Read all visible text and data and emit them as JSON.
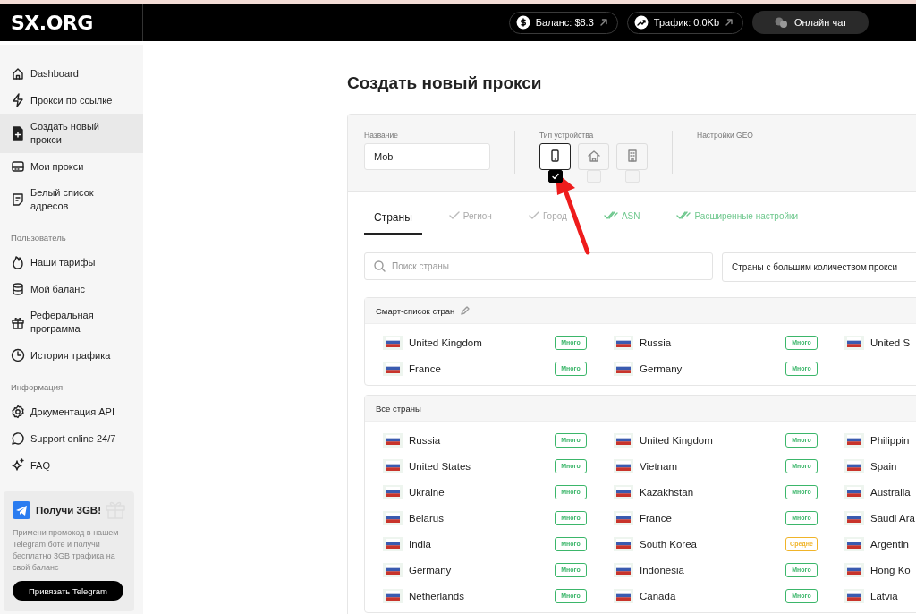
{
  "logo": "SX.ORG",
  "header": {
    "pills": [
      {
        "kind": "balance",
        "label": "Баланс: $8.3"
      },
      {
        "kind": "traffic",
        "label": "Трафик: 0.0Kb"
      }
    ],
    "chat_button": "Онлайн чат"
  },
  "sidebar": {
    "sections": [
      {
        "items": [
          {
            "kind": "home",
            "label": "Dashboard",
            "selected": false
          },
          {
            "kind": "bolt",
            "label": "Прокси по ссылке",
            "selected": false
          },
          {
            "kind": "new-file",
            "label": "Создать новый прокси",
            "selected": true
          },
          {
            "kind": "drive",
            "label": "Мои прокси",
            "selected": false
          },
          {
            "kind": "note",
            "label": "Белый список адресов",
            "selected": false
          }
        ]
      },
      {
        "heading": "Пользователь",
        "items": [
          {
            "kind": "flame",
            "label": "Наши тарифы",
            "selected": false
          },
          {
            "kind": "database",
            "label": "Мой баланс",
            "selected": false
          },
          {
            "kind": "gift",
            "label": "Реферальная программа",
            "selected": false
          },
          {
            "kind": "clock",
            "label": "История трафика",
            "selected": false
          }
        ]
      },
      {
        "heading": "Информация",
        "items": [
          {
            "kind": "gear",
            "label": "Документация API",
            "selected": false
          },
          {
            "kind": "chat",
            "label": "Support online 24/7",
            "selected": false
          },
          {
            "kind": "sparkle",
            "label": "FAQ",
            "selected": false
          }
        ]
      }
    ],
    "promo": {
      "title": "Получи 3GB!",
      "text": "Примени промокод в нашем Telegram боте и получи бесплатно 3GB трафика на свой баланс",
      "button": "Привязать Telegram"
    }
  },
  "page_title": "Создать новый прокси",
  "form": {
    "name_field": {
      "label": "Название",
      "value": "Mob"
    },
    "device_type": {
      "label": "Тип устройства",
      "options": [
        {
          "kind": "phone",
          "checked": true
        },
        {
          "kind": "house",
          "checked": false
        },
        {
          "kind": "building",
          "checked": false
        }
      ]
    },
    "geo": {
      "label": "Настройки GEO"
    }
  },
  "tabs": [
    {
      "label": "Страны",
      "selected": true,
      "kind": "plain"
    },
    {
      "label": "Регион",
      "selected": false,
      "kind": "checked"
    },
    {
      "label": "Город",
      "selected": false,
      "kind": "checked"
    },
    {
      "label": "ASN",
      "selected": false,
      "kind": "double_checked"
    },
    {
      "label": "Расширенные настройки",
      "selected": false,
      "kind": "double_checked"
    }
  ],
  "search": {
    "placeholder": "Поиск страны"
  },
  "sort_dropdown": {
    "value": "Страны с большим количеством прокси"
  },
  "panels": [
    {
      "title": "Смарт-список стран",
      "editable": true,
      "rows": [
        [
          {
            "country": "United Kingdom",
            "badge": "Много",
            "color": "#3bb66a"
          },
          {
            "country": "Russia",
            "badge": "Много",
            "color": "#3bb66a"
          },
          {
            "country": "United S"
          }
        ],
        [
          {
            "country": "France",
            "badge": "Много",
            "color": "#3bb66a"
          },
          {
            "country": "Germany",
            "badge": "Много",
            "color": "#3bb66a"
          }
        ]
      ]
    },
    {
      "title": "Все страны",
      "editable": false,
      "rows": [
        [
          {
            "country": "Russia",
            "badge": "Много",
            "color": "#3bb66a"
          },
          {
            "country": "United Kingdom",
            "badge": "Много",
            "color": "#3bb66a"
          },
          {
            "country": "Philippin"
          }
        ],
        [
          {
            "country": "United States",
            "badge": "Много",
            "color": "#3bb66a"
          },
          {
            "country": "Vietnam",
            "badge": "Много",
            "color": "#3bb66a"
          },
          {
            "country": "Spain"
          }
        ],
        [
          {
            "country": "Ukraine",
            "badge": "Много",
            "color": "#3bb66a"
          },
          {
            "country": "Kazakhstan",
            "badge": "Много",
            "color": "#3bb66a"
          },
          {
            "country": "Australia"
          }
        ],
        [
          {
            "country": "Belarus",
            "badge": "Много",
            "color": "#3bb66a"
          },
          {
            "country": "France",
            "badge": "Много",
            "color": "#3bb66a"
          },
          {
            "country": "Saudi Ara"
          }
        ],
        [
          {
            "country": "India",
            "badge": "Много",
            "color": "#3bb66a"
          },
          {
            "country": "South Korea",
            "badge": "Средне",
            "color": "#f0b429"
          },
          {
            "country": "Argentin"
          }
        ],
        [
          {
            "country": "Germany",
            "badge": "Много",
            "color": "#3bb66a"
          },
          {
            "country": "Indonesia",
            "badge": "Много",
            "color": "#3bb66a"
          },
          {
            "country": "Hong Ko"
          }
        ],
        [
          {
            "country": "Netherlands",
            "badge": "Много",
            "color": "#3bb66a"
          },
          {
            "country": "Canada",
            "badge": "Много",
            "color": "#3bb66a"
          },
          {
            "country": "Latvia"
          }
        ]
      ]
    }
  ]
}
